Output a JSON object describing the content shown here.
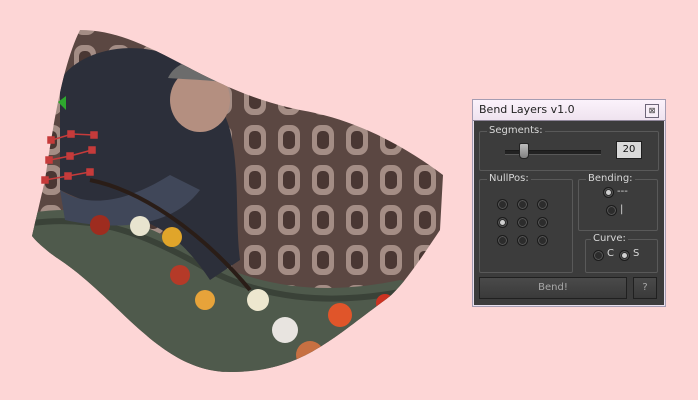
{
  "window": {
    "title": "Bend Layers v1.0",
    "close_glyph": "⊠"
  },
  "segments": {
    "label": "Segments:",
    "value": "20"
  },
  "nullpos": {
    "label": "NullPos:",
    "selected_index": 3
  },
  "bending": {
    "label": "Bending:",
    "options": [
      "---",
      "|"
    ],
    "selected": "---"
  },
  "curve": {
    "label": "Curve:",
    "options": [
      "C",
      "S"
    ],
    "selected": "S"
  },
  "actions": {
    "bend_label": "Bend!",
    "help_label": "?"
  },
  "icons": {
    "close": "close-icon"
  }
}
